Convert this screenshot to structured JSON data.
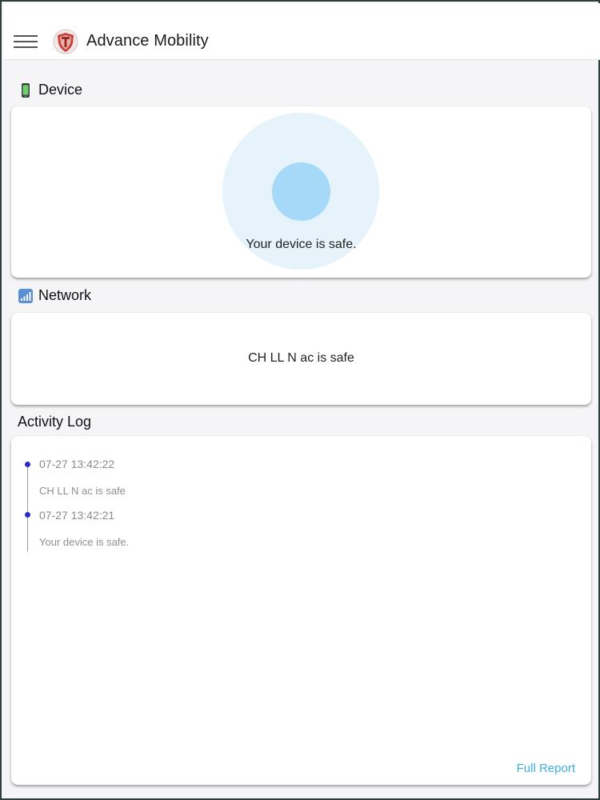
{
  "app": {
    "title": "Advance Mobility",
    "menu_icon": "hamburger-menu-icon",
    "logo_icon": "shield-logo-icon"
  },
  "device": {
    "section_title": "Device",
    "section_icon": "mobile-phone-icon",
    "status_text": "Your device is safe."
  },
  "network": {
    "section_title": "Network",
    "section_icon": "signal-bars-icon",
    "status_text": "CH LL N ac is safe"
  },
  "activity": {
    "section_title": "Activity Log",
    "entries": [
      {
        "time": "07-27 13:42:22",
        "message": "CH LL N ac is safe"
      },
      {
        "time": "07-27 13:42:21",
        "message": "Your device is safe."
      }
    ],
    "full_report_label": "Full Report"
  },
  "colors": {
    "accent_link": "#3ab0e2",
    "radar_outer": "#e6f3fb",
    "radar_inner": "#a6d8f8",
    "timeline_dot": "#2a2ac9"
  }
}
